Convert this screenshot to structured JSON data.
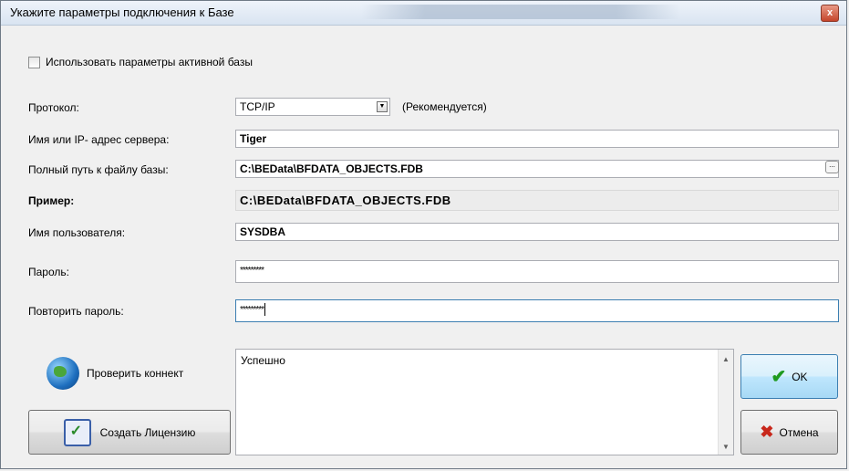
{
  "window": {
    "title": "Укажите параметры подключения к Базе",
    "close_symbol": "x"
  },
  "use_active": {
    "label": "Использовать параметры активной базы",
    "checked": false
  },
  "protocol": {
    "label": "Протокол:",
    "value": "TCP/IP",
    "note": "(Рекомендуется)"
  },
  "server": {
    "label": "Имя или IP- адрес сервера:",
    "value": "Tiger"
  },
  "db_path": {
    "label": "Полный путь к файлу базы:",
    "value": "C:\\BEData\\BFDATA_OBJECTS.FDB",
    "browse_symbol": "..."
  },
  "example": {
    "label": "Пример:",
    "value": "C:\\BEData\\BFDATA_OBJECTS.FDB"
  },
  "user": {
    "label": "Имя пользователя:",
    "value": "SYSDBA"
  },
  "password": {
    "label": "Пароль:",
    "value": "*********"
  },
  "password_repeat": {
    "label": "Повторить пароль:",
    "value": "*********"
  },
  "actions": {
    "check_connect": "Проверить коннект",
    "create_license": "Создать Лицензию",
    "ok": "OK",
    "cancel": "Отмена"
  },
  "log": {
    "text": "Успешно"
  },
  "icons": {
    "globe": "globe-icon",
    "license": "license-icon",
    "ok": "checkmark-icon",
    "cancel": "cross-icon",
    "dropdown": "chevron-down-icon"
  }
}
